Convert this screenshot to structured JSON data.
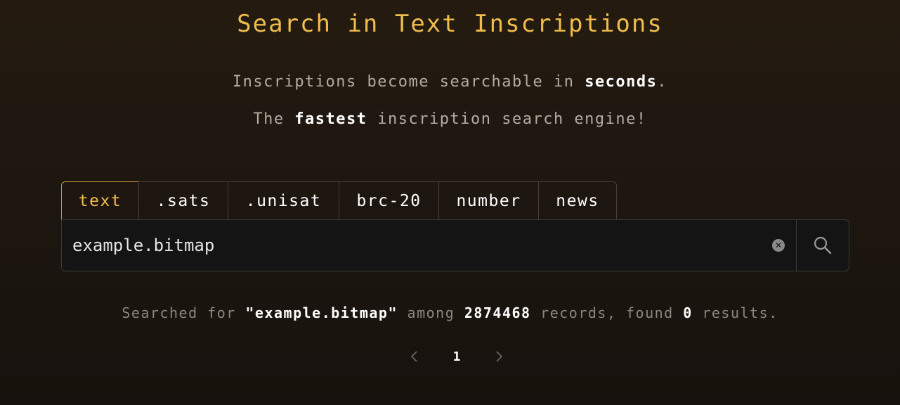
{
  "header": {
    "title": "Search in Text Inscriptions",
    "line1": {
      "pre": "Inscriptions become searchable in ",
      "bold": "seconds",
      "post": "."
    },
    "line2": {
      "pre": "The ",
      "bold": "fastest",
      "post": " inscription search engine!"
    }
  },
  "tabs": [
    {
      "label": "text",
      "active": true
    },
    {
      "label": ".sats",
      "active": false
    },
    {
      "label": ".unisat",
      "active": false
    },
    {
      "label": "brc-20",
      "active": false
    },
    {
      "label": "number",
      "active": false
    },
    {
      "label": "news",
      "active": false
    }
  ],
  "search": {
    "value": "example.bitmap",
    "clear_glyph": "✕",
    "icon": "search-icon"
  },
  "results": {
    "prefix": "Searched for ",
    "query": "\"example.bitmap\"",
    "among": " among ",
    "count": "2874468",
    "records": " records, found ",
    "found": "0",
    "suffix": " results."
  },
  "pagination": {
    "current": "1",
    "prev_icon": "chevron-left-icon",
    "next_icon": "chevron-right-icon"
  },
  "colors": {
    "accent": "#f0bc4c",
    "background": "#1e1710",
    "input_bg": "#141414"
  }
}
